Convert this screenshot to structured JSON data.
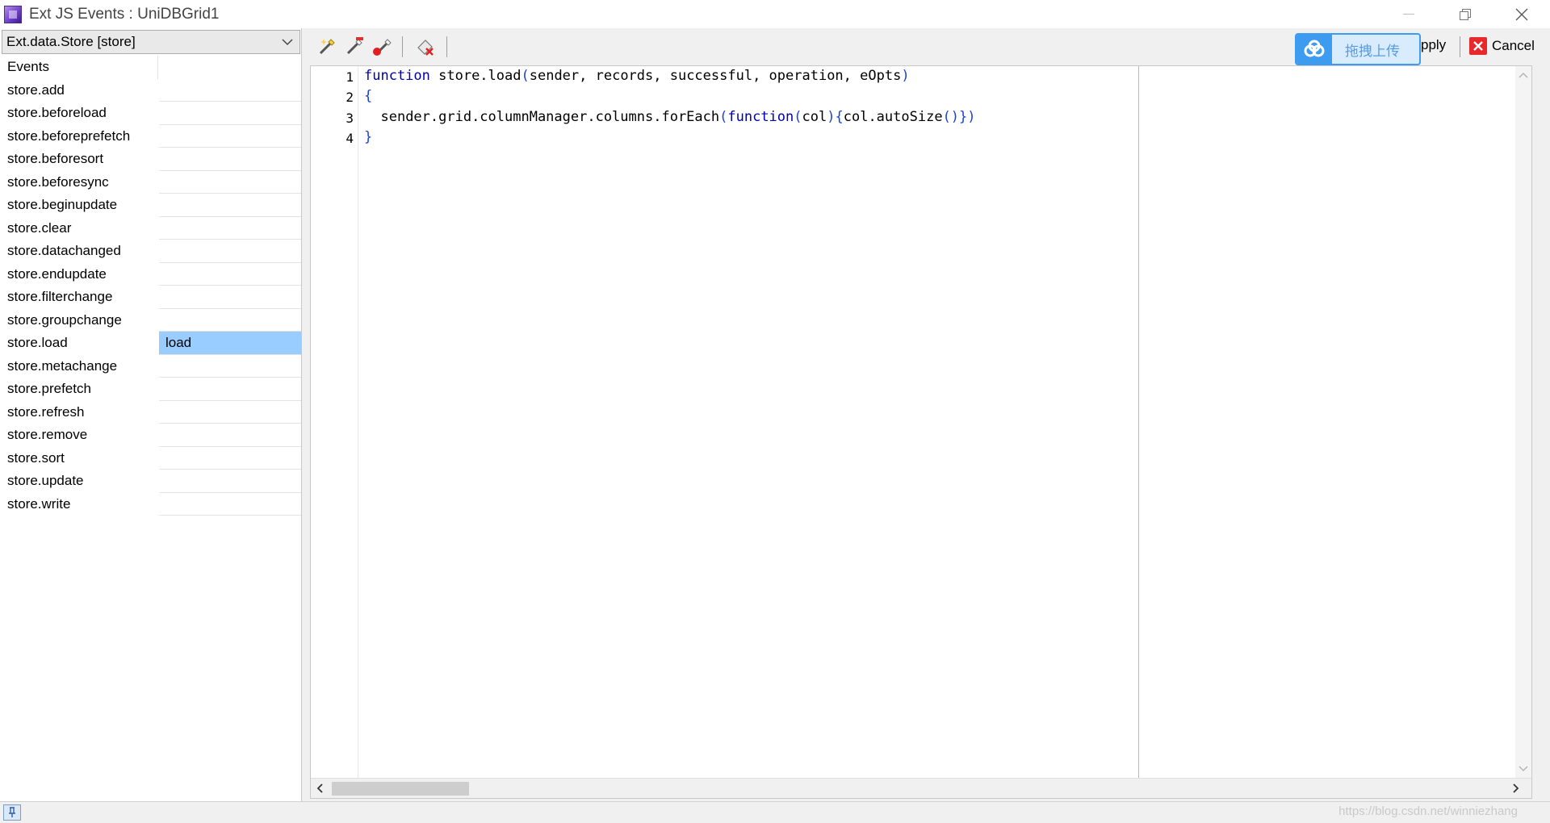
{
  "window": {
    "title": "Ext JS Events : UniDBGrid1"
  },
  "left_panel": {
    "store_select_value": "Ext.data.Store [store]",
    "header": "Events",
    "events": [
      {
        "name": "store.add",
        "handler": ""
      },
      {
        "name": "store.beforeload",
        "handler": ""
      },
      {
        "name": "store.beforeprefetch",
        "handler": ""
      },
      {
        "name": "store.beforesort",
        "handler": ""
      },
      {
        "name": "store.beforesync",
        "handler": ""
      },
      {
        "name": "store.beginupdate",
        "handler": ""
      },
      {
        "name": "store.clear",
        "handler": ""
      },
      {
        "name": "store.datachanged",
        "handler": ""
      },
      {
        "name": "store.endupdate",
        "handler": ""
      },
      {
        "name": "store.filterchange",
        "handler": ""
      },
      {
        "name": "store.groupchange",
        "handler": ""
      },
      {
        "name": "store.load",
        "handler": "load"
      },
      {
        "name": "store.metachange",
        "handler": ""
      },
      {
        "name": "store.prefetch",
        "handler": ""
      },
      {
        "name": "store.refresh",
        "handler": ""
      },
      {
        "name": "store.remove",
        "handler": ""
      },
      {
        "name": "store.sort",
        "handler": ""
      },
      {
        "name": "store.update",
        "handler": ""
      },
      {
        "name": "store.write",
        "handler": ""
      }
    ],
    "selected_event": "store.load"
  },
  "toolbar": {
    "upload_label": "拖拽上传",
    "apply_label": "pply",
    "cancel_label": "Cancel"
  },
  "editor": {
    "line_numbers": [
      "1",
      "2",
      "3",
      "4"
    ],
    "lines": [
      {
        "kw": "function",
        "rest": " store.load",
        "p1": "(",
        "args": "sender, records, successful, operation, eOpts",
        "p2": ")"
      },
      {
        "brace": "{"
      },
      {
        "indent": "  ",
        "obj": "sender.grid.columnManager.columns.forEach",
        "p1": "(",
        "kw": "function",
        "p2": "(",
        "arg": "col",
        "p3": ")",
        "p4": "{",
        "body": "col.autoSize",
        "p5": "()",
        "p6": "}",
        "p7": ")"
      },
      {
        "brace": "}"
      }
    ]
  },
  "statusbar": {
    "watermark": "https://blog.csdn.net/winniezhang"
  },
  "colors": {
    "keyword": "#0000aa",
    "punctuation": "#1b3fd9",
    "selected_handler_bg": "#99ccff",
    "upload_accent": "#3d9bf0",
    "cancel_red": "#e8282a"
  }
}
